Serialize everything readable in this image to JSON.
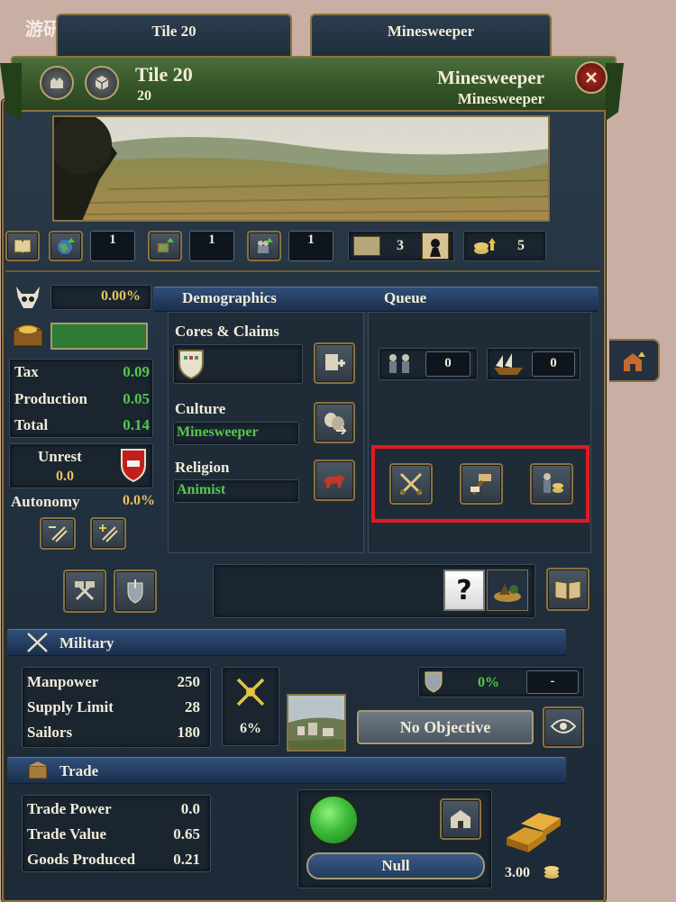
{
  "watermark": "游研社",
  "tabs": [
    {
      "label": "Tile 20"
    },
    {
      "label": "Minesweeper"
    }
  ],
  "header": {
    "title": "Tile 20",
    "subtitle": "20",
    "owner_name": "Minesweeper",
    "owner_sub": "Minesweeper"
  },
  "stat_row": {
    "tax_dev": "1",
    "prod_dev": "1",
    "manpower_dev": "1",
    "trade_goods_level": "3",
    "dev_total": "5"
  },
  "economy": {
    "devastation": "0.00%",
    "tax_label": "Tax",
    "tax_value": "0.09",
    "production_label": "Production",
    "production_value": "0.05",
    "total_label": "Total",
    "total_value": "0.14",
    "unrest_label": "Unrest",
    "unrest_value": "0.0",
    "autonomy_label": "Autonomy",
    "autonomy_value": "0.0%"
  },
  "demographics": {
    "tab_label": "Demographics",
    "queue_label": "Queue",
    "cores_label": "Cores & Claims",
    "culture_label": "Culture",
    "culture_value": "Minesweeper",
    "religion_label": "Religion",
    "religion_value": "Animist"
  },
  "queue": {
    "units_count": "0",
    "ships_count": "0"
  },
  "help_label": "?",
  "military": {
    "title": "Military",
    "manpower_label": "Manpower",
    "manpower_value": "250",
    "supply_label": "Supply Limit",
    "supply_value": "28",
    "sailors_label": "Sailors",
    "sailors_value": "180",
    "fort_percent": "6%",
    "siege_percent": "0%",
    "siege_extra": "-",
    "objective_button": "No Objective"
  },
  "trade": {
    "title": "Trade",
    "power_label": "Trade Power",
    "power_value": "0.0",
    "value_label": "Trade Value",
    "value_value": "0.65",
    "goods_label": "Goods Produced",
    "goods_value": "0.21",
    "node_button": "Null",
    "goods_price": "3.00"
  },
  "colors": {
    "accent_gold": "#8a7240",
    "positive_green": "#55c84a",
    "section_blue": "#233c5e",
    "highlight_red": "#e01a22"
  }
}
